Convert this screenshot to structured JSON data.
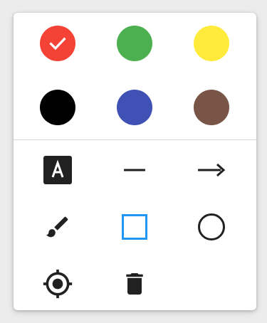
{
  "palette": {
    "colors": [
      {
        "name": "red",
        "hex": "#f44336",
        "selected": true
      },
      {
        "name": "green",
        "hex": "#4caf50",
        "selected": false
      },
      {
        "name": "yellow",
        "hex": "#ffeb3b",
        "selected": false
      },
      {
        "name": "black",
        "hex": "#000000",
        "selected": false
      },
      {
        "name": "blue",
        "hex": "#3f51b5",
        "selected": false
      },
      {
        "name": "brown",
        "hex": "#795548",
        "selected": false
      }
    ],
    "check_icon": "check-icon"
  },
  "tools": [
    {
      "icon": "text-icon",
      "active": false
    },
    {
      "icon": "line-icon",
      "active": false
    },
    {
      "icon": "arrow-icon",
      "active": false
    },
    {
      "icon": "brush-icon",
      "active": false
    },
    {
      "icon": "rectangle-icon",
      "active": true
    },
    {
      "icon": "circle-icon",
      "active": false
    },
    {
      "icon": "target-icon",
      "active": false
    },
    {
      "icon": "trash-icon",
      "active": false
    }
  ],
  "colors": {
    "active_tool": "#2196f3",
    "tool": "#212121"
  }
}
